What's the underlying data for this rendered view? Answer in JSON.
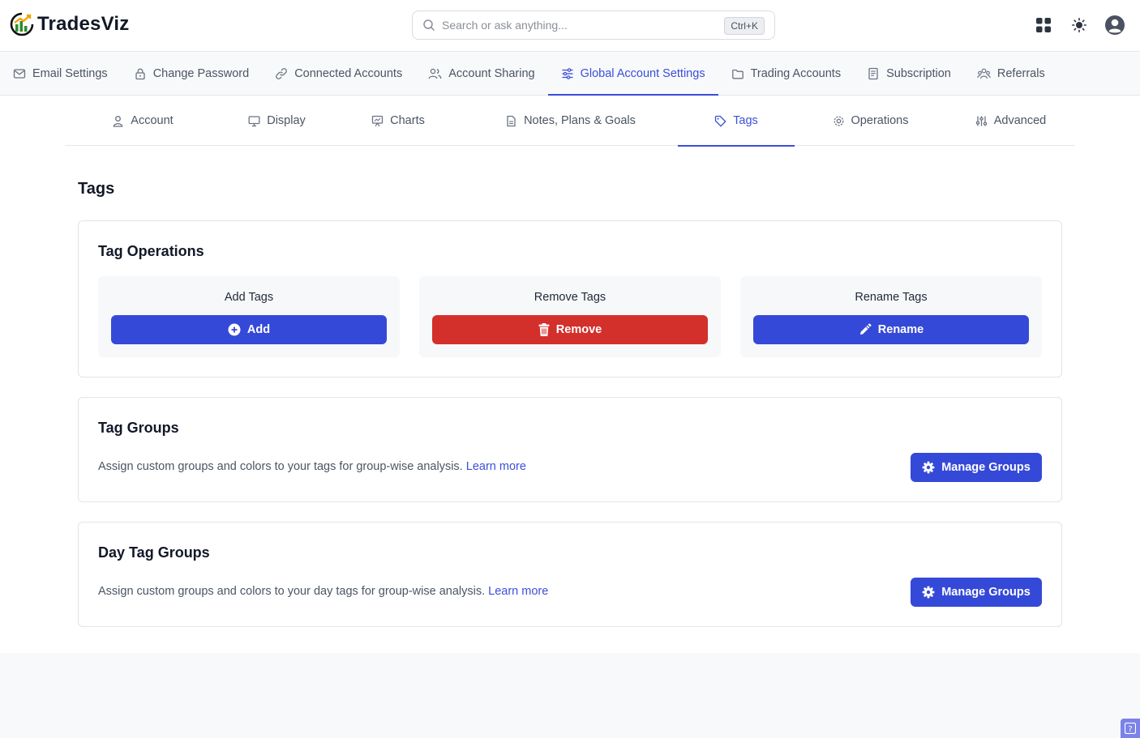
{
  "app": {
    "name": "TradesViz",
    "search_placeholder": "Search or ask anything...",
    "search_shortcut": "Ctrl+K"
  },
  "main_nav": [
    {
      "label": "Email Settings",
      "icon": "mail-icon"
    },
    {
      "label": "Change Password",
      "icon": "lock-icon"
    },
    {
      "label": "Connected Accounts",
      "icon": "link-icon"
    },
    {
      "label": "Account Sharing",
      "icon": "users-icon"
    },
    {
      "label": "Global Account Settings",
      "icon": "sliders-icon",
      "active": true
    },
    {
      "label": "Trading Accounts",
      "icon": "folder-icon"
    },
    {
      "label": "Subscription",
      "icon": "receipt-icon"
    },
    {
      "label": "Referrals",
      "icon": "people-icon"
    }
  ],
  "sub_nav": [
    {
      "label": "Account",
      "icon": "user-icon"
    },
    {
      "label": "Display",
      "icon": "monitor-icon"
    },
    {
      "label": "Charts",
      "icon": "presentation-icon"
    },
    {
      "label": "Notes, Plans & Goals",
      "icon": "document-icon"
    },
    {
      "label": "Tags",
      "icon": "tag-icon",
      "active": true
    },
    {
      "label": "Operations",
      "icon": "gear-icon"
    },
    {
      "label": "Advanced",
      "icon": "adjustments-icon"
    }
  ],
  "page": {
    "title": "Tags"
  },
  "tag_operations": {
    "title": "Tag Operations",
    "add": {
      "label": "Add Tags",
      "button": "Add"
    },
    "remove": {
      "label": "Remove Tags",
      "button": "Remove"
    },
    "rename": {
      "label": "Rename Tags",
      "button": "Rename"
    }
  },
  "tag_groups": {
    "title": "Tag Groups",
    "description": "Assign custom groups and colors to your tags for group-wise analysis.",
    "link": "Learn more",
    "button": "Manage Groups"
  },
  "day_tag_groups": {
    "title": "Day Tag Groups",
    "description": "Assign custom groups and colors to your day tags for group-wise analysis.",
    "link": "Learn more",
    "button": "Manage Groups"
  },
  "help": {
    "label": "?"
  },
  "colors": {
    "accent": "#3b4fd8",
    "button_blue": "#3549d8",
    "button_red": "#d3302c"
  }
}
